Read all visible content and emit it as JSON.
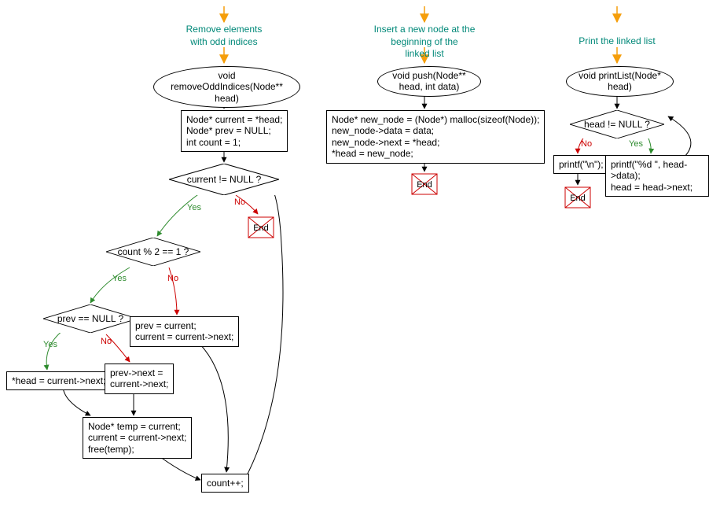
{
  "flow1": {
    "title": "Remove elements\nwith odd indices",
    "start": "void removeOddIndices(Node**\nhead)",
    "p_init": "Node* current = *head;\nNode* prev = NULL;\nint count = 1;",
    "d_cur": "current != NULL ?",
    "d_count": "count % 2 == 1 ?",
    "d_prev": "prev == NULL ?",
    "p_prevcur": "prev = current;\ncurrent = current->next;",
    "p_headnext": "*head = current->next;",
    "p_prevnext": "prev->next =\ncurrent->next;",
    "p_free": "Node* temp = current;\ncurrent = current->next;\nfree(temp);",
    "p_countpp": "count++;",
    "yes": "Yes",
    "no": "No"
  },
  "flow2": {
    "title": "Insert a new node at the\nbeginning of the\nlinked list",
    "start": "void push(Node**\nhead, int data)",
    "p_body": "Node* new_node = (Node*) malloc(sizeof(Node));\nnew_node->data = data;\nnew_node->next = *head;\n*head = new_node;"
  },
  "flow3": {
    "title": "Print the linked list",
    "start": "void printList(Node*\nhead)",
    "d_head": "head != NULL ?",
    "p_print": "printf(\"%d \", head->data);\nhead = head->next;",
    "p_nl": "printf(\"\\n\");",
    "yes": "Yes",
    "no": "No"
  },
  "end_label": "End"
}
